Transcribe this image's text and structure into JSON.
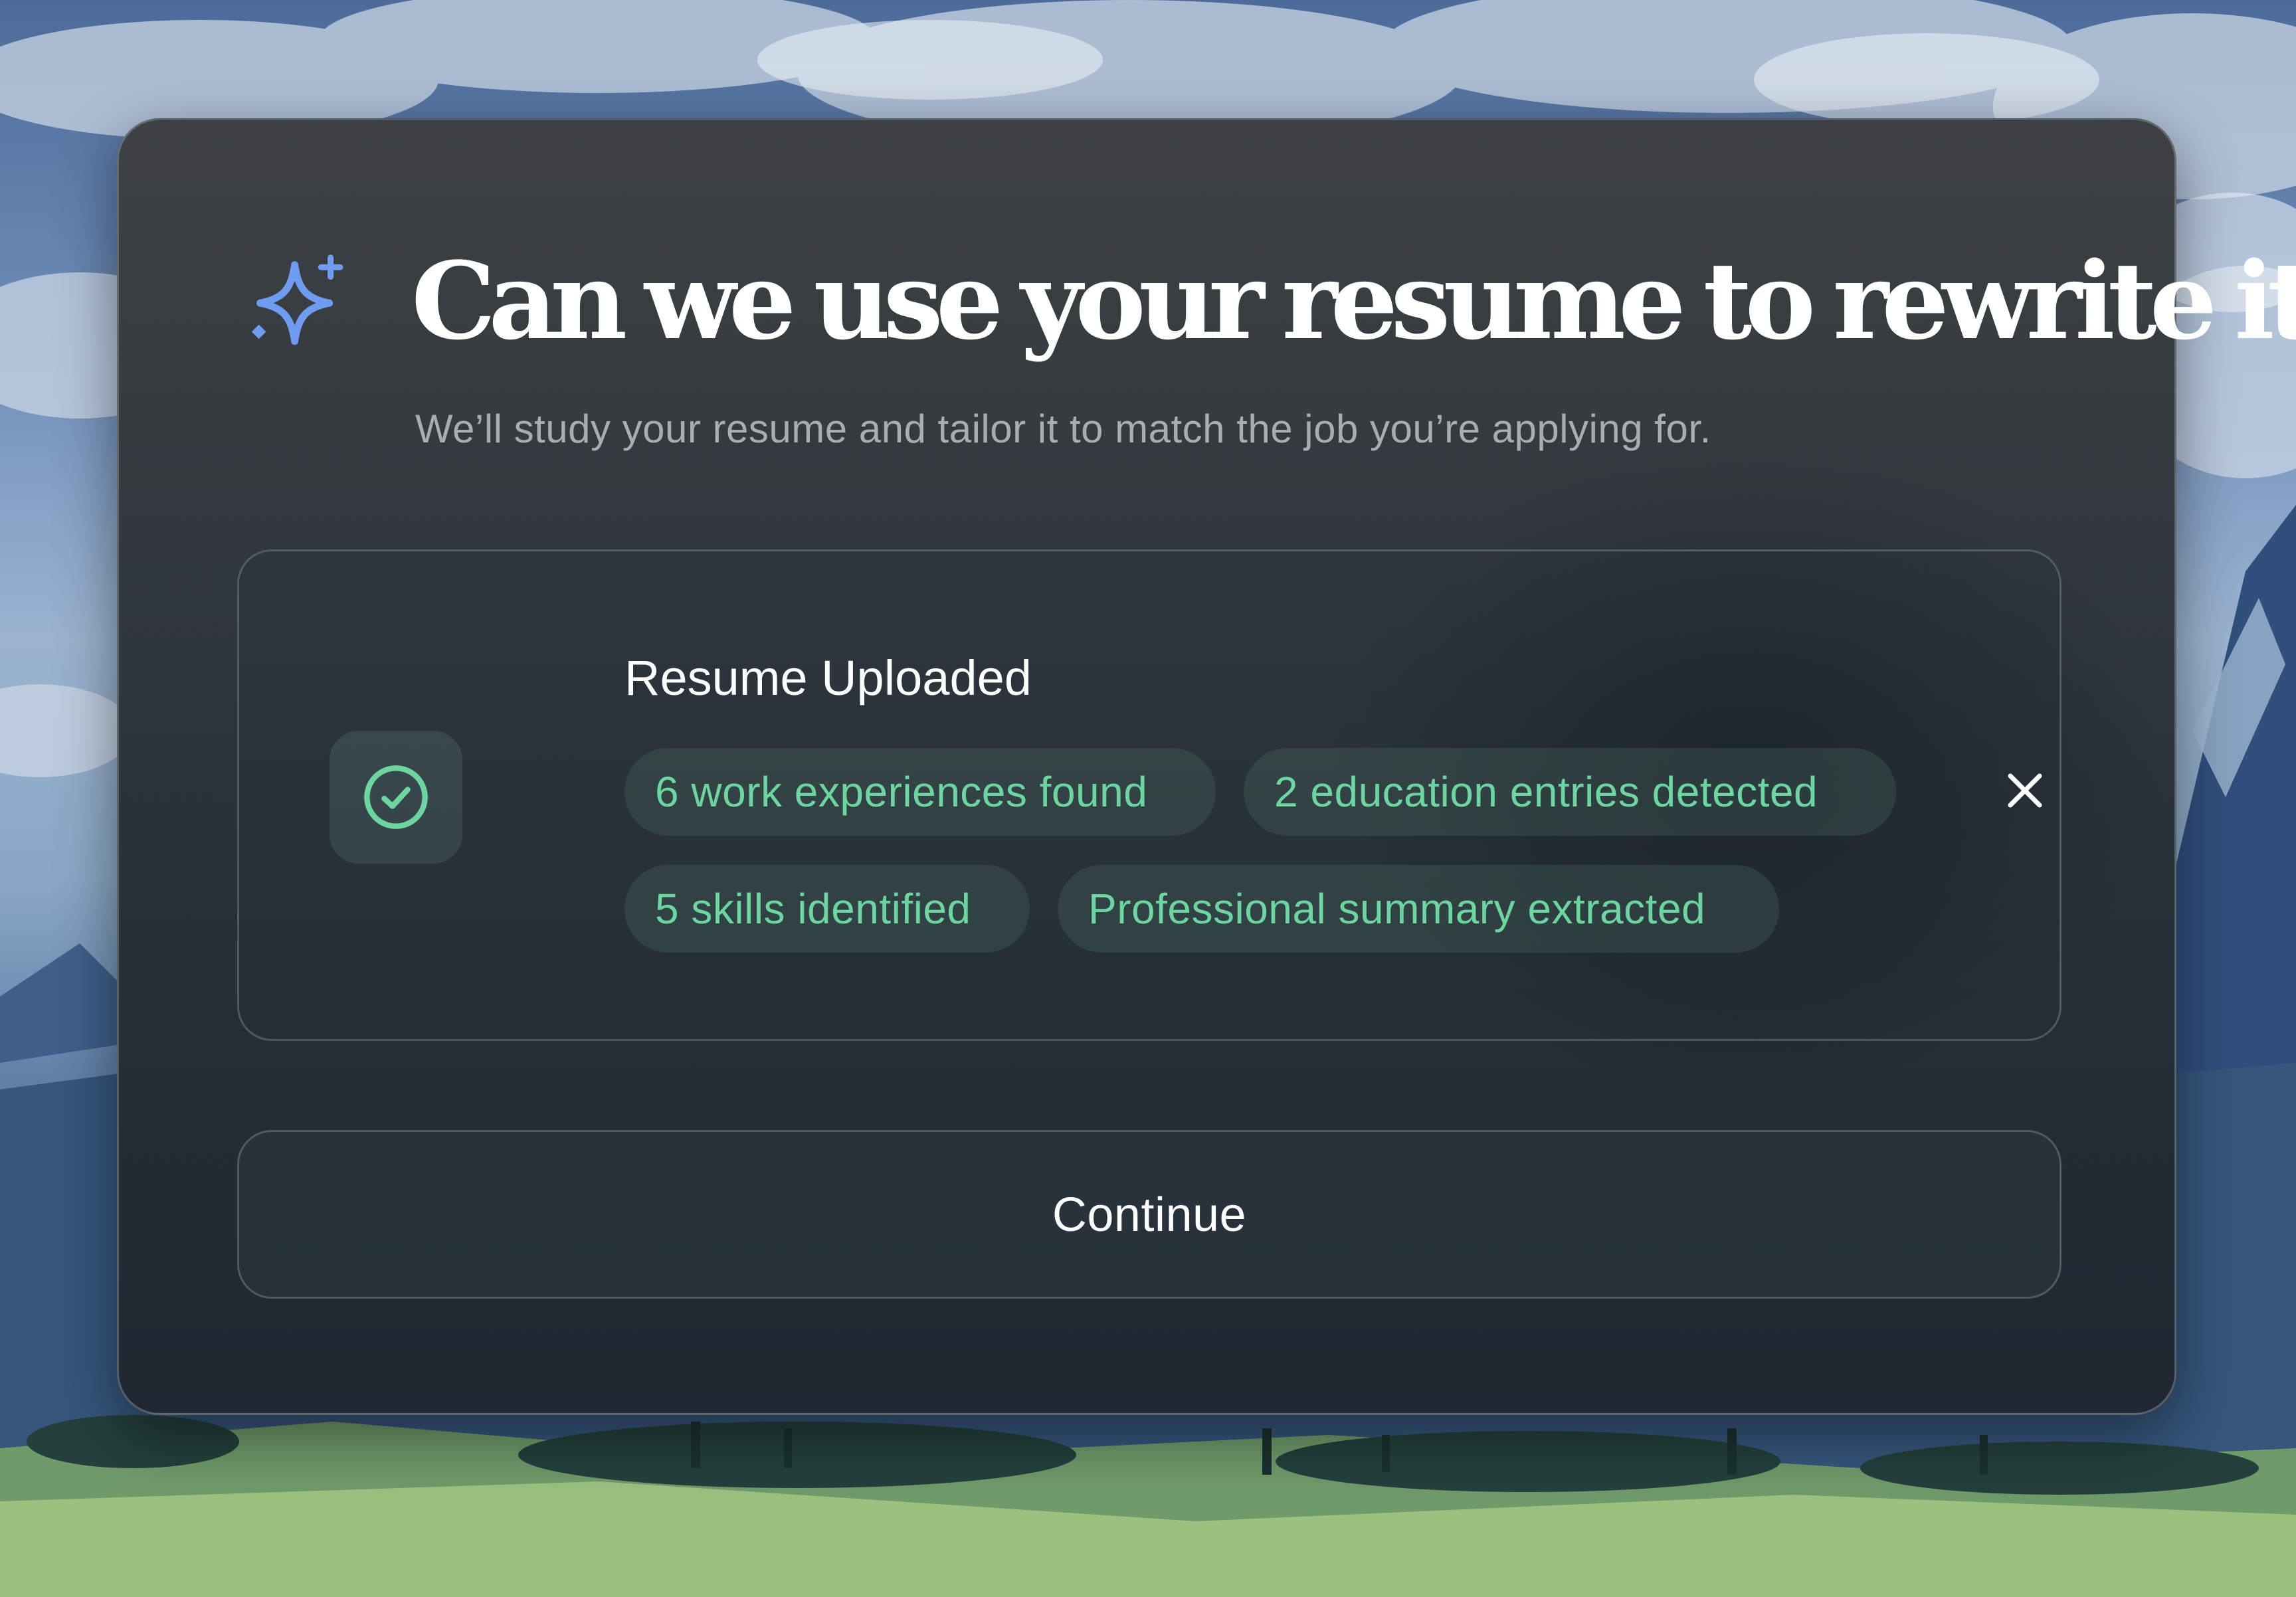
{
  "dialog": {
    "title": "Can we use your resume to rewrite it?",
    "subtitle": "We’ll study your resume and tailor it to match the job you’re applying for.",
    "title_icon": "sparkle-icon",
    "accent_color": "#6f9bf0"
  },
  "upload": {
    "status_icon": "check-circle-icon",
    "title": "Resume Uploaded",
    "tags": [
      "6 work experiences found",
      "2 education entries detected",
      "5 skills identified",
      "Professional summary extracted"
    ],
    "tag_color": "#6dd6a0",
    "remove_icon": "close-icon"
  },
  "actions": {
    "continue_label": "Continue"
  }
}
